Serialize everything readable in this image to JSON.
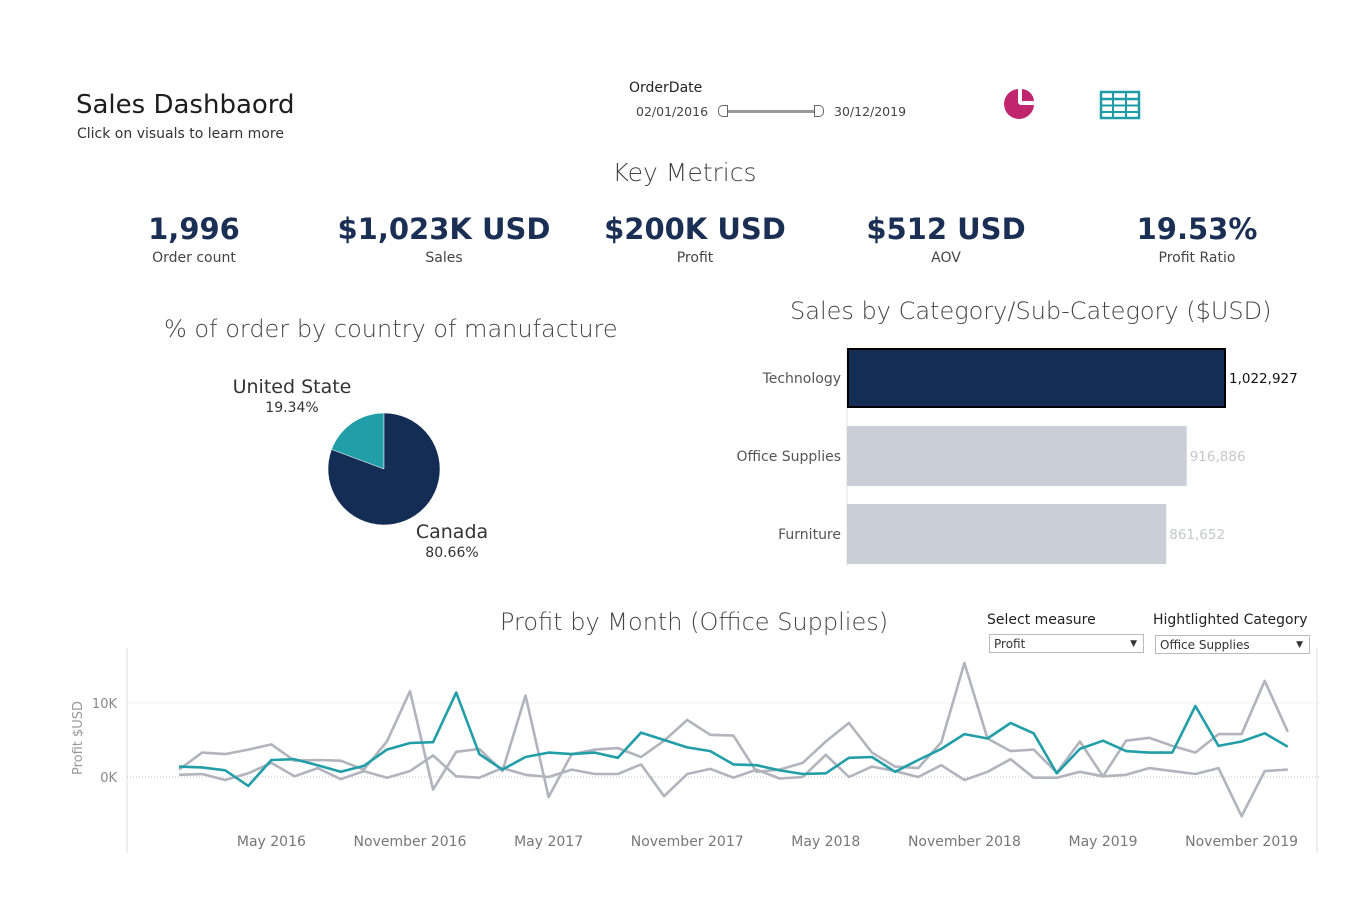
{
  "header": {
    "title": "Sales Dashbaord",
    "subtitle": "Click on visuals to learn more"
  },
  "filter": {
    "label": "OrderDate",
    "start": "02/01/2016",
    "end": "30/12/2019"
  },
  "toolbar": {
    "pie_icon": "pie-chart-icon",
    "table_icon": "table-grid-icon",
    "pie_color": "#c0266e",
    "table_color": "#1e9ba6"
  },
  "key_metrics": {
    "title": "Key Metrics",
    "items": [
      {
        "value": "1,996",
        "label": "Order count"
      },
      {
        "value": "$1,023K USD",
        "label": "Sales"
      },
      {
        "value": "$200K USD",
        "label": "Profit"
      },
      {
        "value": "$512 USD",
        "label": "AOV"
      },
      {
        "value": "19.53%",
        "label": "Profit  Ratio"
      }
    ]
  },
  "controls": {
    "select_measure_label": "Select measure",
    "select_measure_value": "Profit",
    "highlight_label": "Hightlighted Category",
    "highlight_value": "Office Supplies"
  },
  "colors": {
    "navy": "#142d55",
    "teal": "#229ea8",
    "grey_bar": "#c9ced7",
    "grey_line": "#b2b3bc"
  },
  "chart_data": [
    {
      "type": "pie",
      "title": "% of order by country of manufacture",
      "slices": [
        {
          "label": "United State",
          "value": 19.34,
          "display": "19.34%",
          "color": "#229ea8"
        },
        {
          "label": "Canada",
          "value": 80.66,
          "display": "80.66%",
          "color": "#142d55"
        }
      ]
    },
    {
      "type": "bar",
      "orientation": "horizontal",
      "title": "Sales by Category/Sub-Category ($USD)",
      "categories": [
        "Technology",
        "Office Supplies",
        "Furniture"
      ],
      "values": [
        1022927,
        916886,
        861652
      ],
      "value_labels": [
        "1,022,927",
        "916,886",
        "861,652"
      ],
      "highlighted": "Technology"
    },
    {
      "type": "line",
      "title": "Profit by Month (Office Supplies)",
      "ylabel": "Profit  $USD",
      "ylim": [
        -6500,
        17000
      ],
      "yticks": [
        0,
        10000
      ],
      "ytick_labels": [
        "0K",
        "10K"
      ],
      "x_start": "2016-01",
      "xtick_labels": [
        "May 2016",
        "November 2016",
        "May 2017",
        "November 2017",
        "May 2018",
        "November 2018",
        "May 2019",
        "November 2019"
      ],
      "xtick_months": [
        4,
        10,
        16,
        22,
        28,
        34,
        40,
        46
      ],
      "series": [
        {
          "name": "Office Supplies",
          "color": "#229ea8",
          "highlight": true,
          "values": [
            1400,
            1300,
            900,
            -1200,
            2300,
            2400,
            1600,
            700,
            1500,
            3700,
            4600,
            4700,
            11400,
            3100,
            1000,
            2700,
            3300,
            3100,
            3300,
            2600,
            6000,
            5000,
            4000,
            3500,
            1700,
            1600,
            900,
            400,
            500,
            2600,
            2700,
            700,
            2300,
            3800,
            5800,
            5200,
            7300,
            5900,
            500,
            3800,
            4900,
            3500,
            3300,
            3300,
            9600,
            4200,
            4800,
            5900,
            4100
          ]
        },
        {
          "name": "Technology",
          "color": "#b2b3bc",
          "values": [
            1000,
            3300,
            3100,
            3700,
            4400,
            2200,
            2300,
            2200,
            1000,
            4800,
            11600,
            -1700,
            3400,
            3800,
            800,
            11000,
            -2700,
            3100,
            3700,
            3900,
            2700,
            4900,
            7700,
            5700,
            5600,
            700,
            1000,
            1900,
            4800,
            7300,
            3300,
            1400,
            1200,
            4700,
            15400,
            5200,
            3500,
            3700,
            600,
            4800,
            100,
            4900,
            5300,
            4200,
            3300,
            5800,
            5800,
            13000,
            6100
          ]
        },
        {
          "name": "Furniture",
          "color": "#b2b3bc",
          "values": [
            300,
            400,
            -400,
            500,
            1900,
            100,
            1200,
            -300,
            800,
            -100,
            800,
            2900,
            100,
            -100,
            1200,
            300,
            0,
            1000,
            400,
            400,
            1700,
            -2600,
            400,
            1100,
            -100,
            1000,
            -200,
            0,
            3000,
            0,
            1400,
            800,
            0,
            1600,
            -400,
            700,
            2400,
            -100,
            -100,
            700,
            100,
            300,
            1200,
            800,
            400,
            1200,
            -5300,
            800,
            1000
          ]
        }
      ]
    }
  ]
}
